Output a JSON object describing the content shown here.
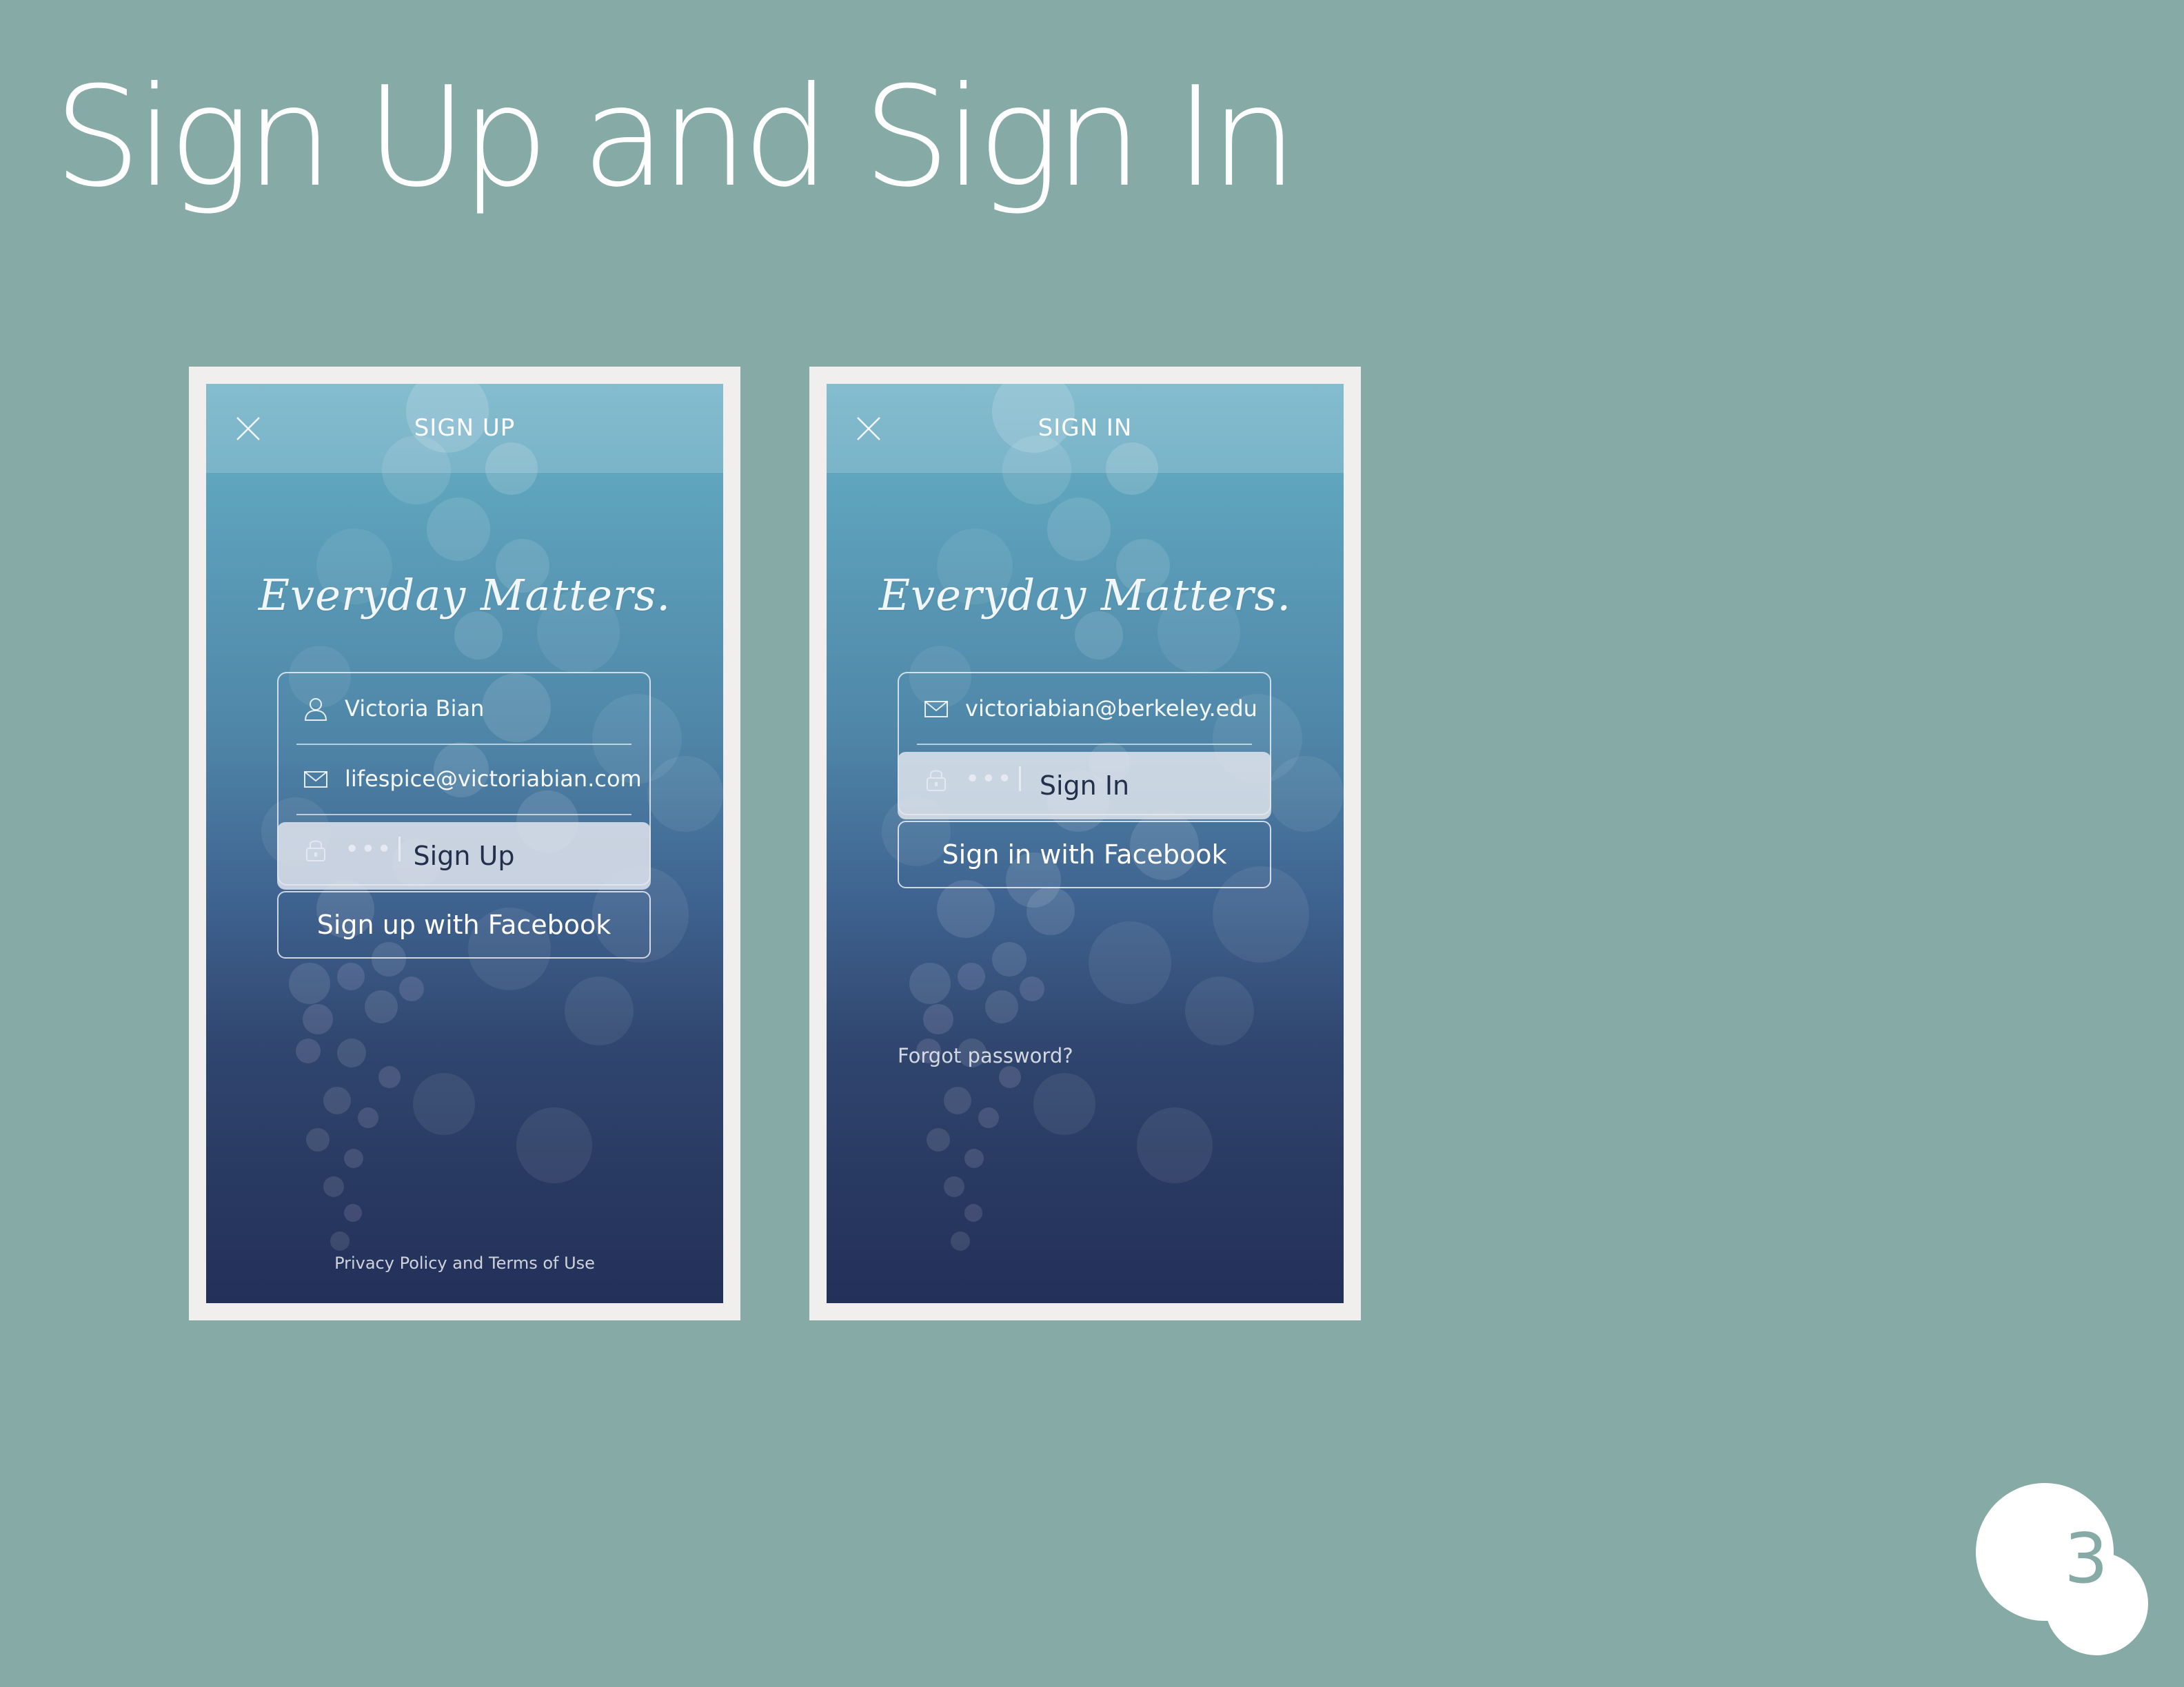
{
  "slide": {
    "title": "Sign Up and Sign In",
    "page_number": "3"
  },
  "colors": {
    "background": "#86aaa5",
    "frame": "#f0efee",
    "gradient_top": "#6eb0c6",
    "gradient_bottom": "#23305a",
    "primary_button": "#e2e6ee",
    "primary_button_text": "#22304c"
  },
  "signup": {
    "nav_title": "SIGN UP",
    "close_icon": "close-icon",
    "brand": "Everyday Matters.",
    "fields": [
      {
        "icon": "user-icon",
        "value": "Victoria Bian"
      },
      {
        "icon": "mail-icon",
        "value": "lifespice@victoriabian.com"
      },
      {
        "icon": "lock-icon",
        "value": "•••"
      }
    ],
    "primary_button": "Sign Up",
    "facebook_button": "Sign up with Facebook",
    "footer": "Privacy Policy and Terms of Use"
  },
  "signin": {
    "nav_title": "SIGN IN",
    "close_icon": "close-icon",
    "brand": "Everyday Matters.",
    "fields": [
      {
        "icon": "mail-icon",
        "value": "victoriabian@berkeley.edu"
      },
      {
        "icon": "lock-icon",
        "value": "•••"
      }
    ],
    "primary_button": "Sign In",
    "facebook_button": "Sign in with Facebook",
    "forgot_link": "Forgot password?"
  }
}
